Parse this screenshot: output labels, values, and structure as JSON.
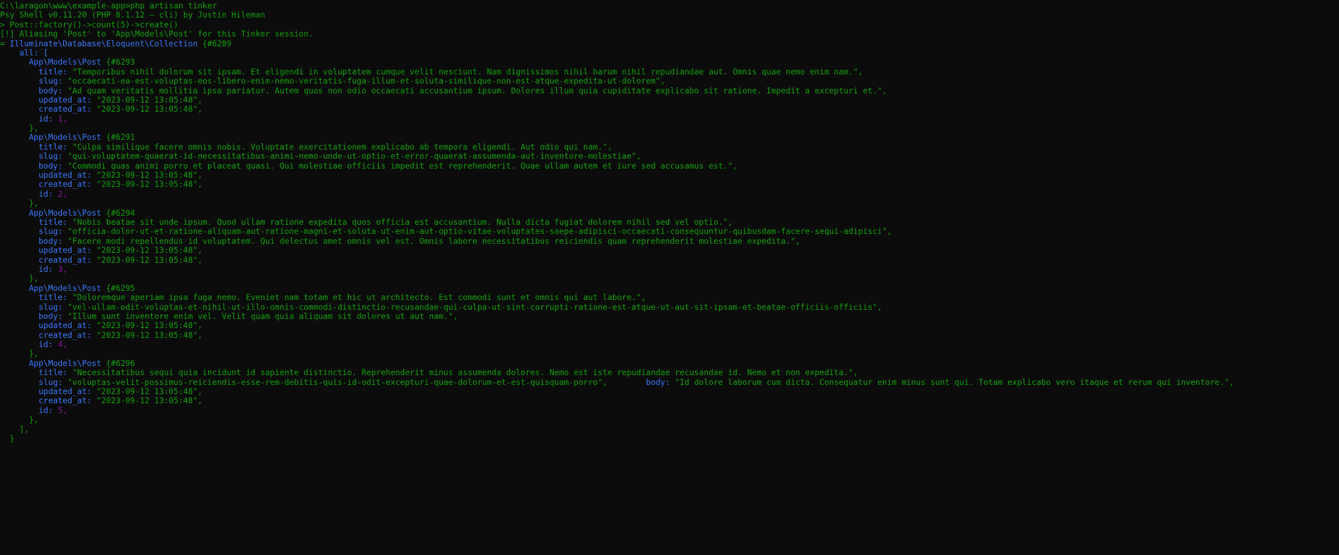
{
  "terminal": {
    "title": "Windows Command Prompt - php artisan tinker",
    "background_color": "#0c0c0c",
    "colors": {
      "green": "#13a10e",
      "blue": "#3b78ff",
      "magenta": "#881798",
      "white": "#cccccc"
    },
    "prompt_path": "C:\\laragon\\www\\example-app>",
    "command": "php artisan tinker",
    "banner": "Psy Shell v0.11.20 (PHP 8.1.12 — cli) by Justin Hileman",
    "psy_prompt": "> ",
    "psy_command": "Post::factory()->count(5)->create()",
    "warning": "[!] Aliasing 'Post' to 'App\\Models\\Post' for this Tinker session.",
    "result_prefix": "= ",
    "result_class": "Illuminate\\Database\\Eloquent\\Collection",
    "result_hash": "{#6289",
    "all_key": "all: [",
    "close_bracket": "],",
    "close_brace": "}",
    "item_close": "},",
    "model_class": "App\\Models\\Post",
    "keys": {
      "title": "title: ",
      "slug": "slug: ",
      "body": "body: ",
      "updated_at": "updated_at: ",
      "created_at": "created_at: ",
      "id": "id: "
    }
  },
  "posts": [
    {
      "hash": "{#6293",
      "title": "\"Temporibus nihil dolorum sit ipsam. Et eligendi in voluptatem cumque velit nesciunt. Nam dignissimos nihil harum nihil repudiandae aut. Omnis quae nemo enim nam.\",",
      "slug": "\"occaecati-ea-est-voluptas-eos-libero-enim-nemo-veritatis-fuga-illum-et-soluta-similique-non-est-atque-expedita-ut-dolorem\",",
      "body": "\"Ad quam veritatis mollitia ipsa pariatur. Autem quos non odio occaecati accusantium ipsum. Dolores illum quia cupiditate explicabo sit ratione. Impedit a excepturi et.\",",
      "updated_at": "\"2023-09-12 13:05:48\",",
      "created_at": "\"2023-09-12 13:05:48\",",
      "id": "1,"
    },
    {
      "hash": "{#6291",
      "title": "\"Culpa similique facere omnis nobis. Voluptate exercitationem explicabo ab tempora eligendi. Aut odio qui nam.\",",
      "slug": "\"qui-voluptatem-quaerat-id-necessitatibus-animi-nemo-unde-ut-optio-et-error-quaerat-assumenda-aut-inventore-molestiae\",",
      "body": "\"Commodi quas animi porro et placeat quasi. Qui molestiae officiis impedit est reprehenderit. Quae ullam autem et iure sed accusamus est.\",",
      "updated_at": "\"2023-09-12 13:05:48\",",
      "created_at": "\"2023-09-12 13:05:48\",",
      "id": "2,"
    },
    {
      "hash": "{#6294",
      "title": "\"Nobis beatae sit unde ipsum. Quod ullam ratione expedita quos officia est accusantium. Nulla dicta fugiat dolorem nihil sed vel optio.\",",
      "slug": "\"officia-dolor-ut-et-ratione-aliquam-aut-ratione-magni-et-soluta-ut-enim-aut-optio-vitae-voluptates-saepe-adipisci-occaecati-consequuntur-quibusdam-facere-sequi-adipisci\",",
      "body": "\"Facere modi repellendus id voluptatem. Qui delectus amet omnis vel est. Omnis labore necessitatibus reiciendis quam reprehenderit molestiae expedita.\",",
      "updated_at": "\"2023-09-12 13:05:48\",",
      "created_at": "\"2023-09-12 13:05:48\",",
      "id": "3,"
    },
    {
      "hash": "{#6295",
      "title": "\"Doloremque aperiam ipsa fuga nemo. Eveniet nam totam et hic ut architecto. Est commodi sunt et omnis qui aut labore.\",",
      "slug": "\"vel-ullam-odit-voluptas-et-nihil-ut-illo-omnis-commodi-distinctio-recusandae-qui-culpa-ut-sint-corrupti-ratione-est-atque-ut-aut-sit-ipsam-et-beatae-officiis-officiis\",",
      "body": "\"Illum sunt inventore enim vel. Velit quam quia aliquam sit dolores ut aut nam.\",",
      "updated_at": "\"2023-09-12 13:05:48\",",
      "created_at": "\"2023-09-12 13:05:48\",",
      "id": "4,"
    },
    {
      "hash": "{#6296",
      "title": "\"Necessitatibus sequi quia incidunt id sapiente distinctio. Reprehenderit minus assumenda dolores. Nemo est iste repudiandae recusandae id. Nemo et non expedita.\",",
      "slug": "\"voluptas-velit-possimus-reiciendis-esse-rem-debitis-quis-id-odit-excepturi-quae-dolorum-et-est-quisquam-porro\",",
      "slug_trailing_spaces": "        ",
      "body_wrapped_prefix": "body: ",
      "body": "\"Id dolore laborum cum dicta. Consequatur enim minus sunt qui. Totam explicabo vero itaque et rerum qui inventore.\",",
      "updated_at": "\"2023-09-12 13:05:48\",",
      "created_at": "\"2023-09-12 13:05:48\",",
      "id": "5,"
    }
  ]
}
